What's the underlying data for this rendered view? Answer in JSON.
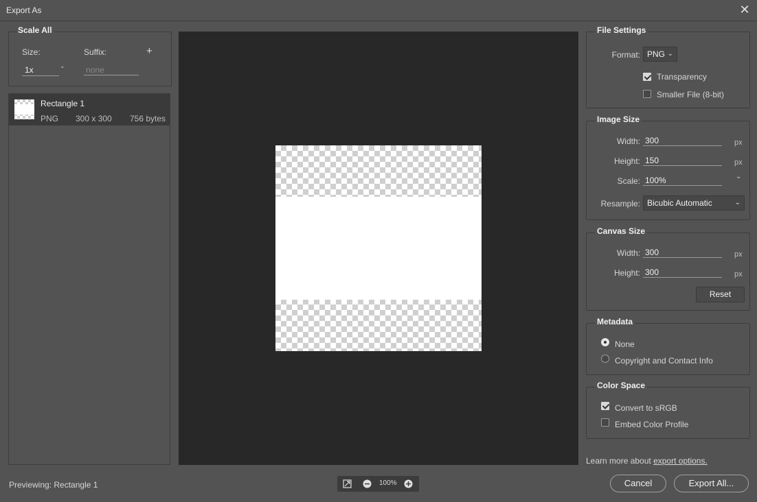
{
  "window": {
    "title": "Export As"
  },
  "scale_all": {
    "legend": "Scale All",
    "size_label": "Size:",
    "suffix_label": "Suffix:",
    "add_icon": "+",
    "size_value": "1x",
    "suffix_placeholder": "none"
  },
  "assets": [
    {
      "name": "Rectangle 1",
      "format": "PNG",
      "dimensions": "300 x 300",
      "filesize": "756 bytes"
    }
  ],
  "preview": {
    "label": "Previewing:",
    "name": "Rectangle 1",
    "zoom": "100%"
  },
  "file_settings": {
    "legend": "File Settings",
    "format_label": "Format:",
    "format_value": "PNG",
    "transparency_label": "Transparency",
    "transparency_checked": true,
    "smaller_file_label": "Smaller File (8-bit)",
    "smaller_file_checked": false
  },
  "image_size": {
    "legend": "Image Size",
    "width_label": "Width:",
    "width_value": "300",
    "height_label": "Height:",
    "height_value": "150",
    "scale_label": "Scale:",
    "scale_value": "100%",
    "resample_label": "Resample:",
    "resample_value": "Bicubic Automatic",
    "unit": "px"
  },
  "canvas_size": {
    "legend": "Canvas Size",
    "width_label": "Width:",
    "width_value": "300",
    "height_label": "Height:",
    "height_value": "300",
    "unit": "px",
    "reset_label": "Reset"
  },
  "metadata": {
    "legend": "Metadata",
    "options": [
      "None",
      "Copyright and Contact Info"
    ],
    "selected": "None"
  },
  "color_space": {
    "legend": "Color Space",
    "convert_label": "Convert to sRGB",
    "convert_checked": true,
    "embed_label": "Embed Color Profile",
    "embed_checked": false
  },
  "footer": {
    "learn_more_text": "Learn more about",
    "learn_more_link": "export options.",
    "cancel_label": "Cancel",
    "export_label": "Export All..."
  },
  "colors": {
    "dialog_bg": "#535353",
    "preview_bg": "#282828",
    "selected_row_bg": "#3a3a3a"
  }
}
